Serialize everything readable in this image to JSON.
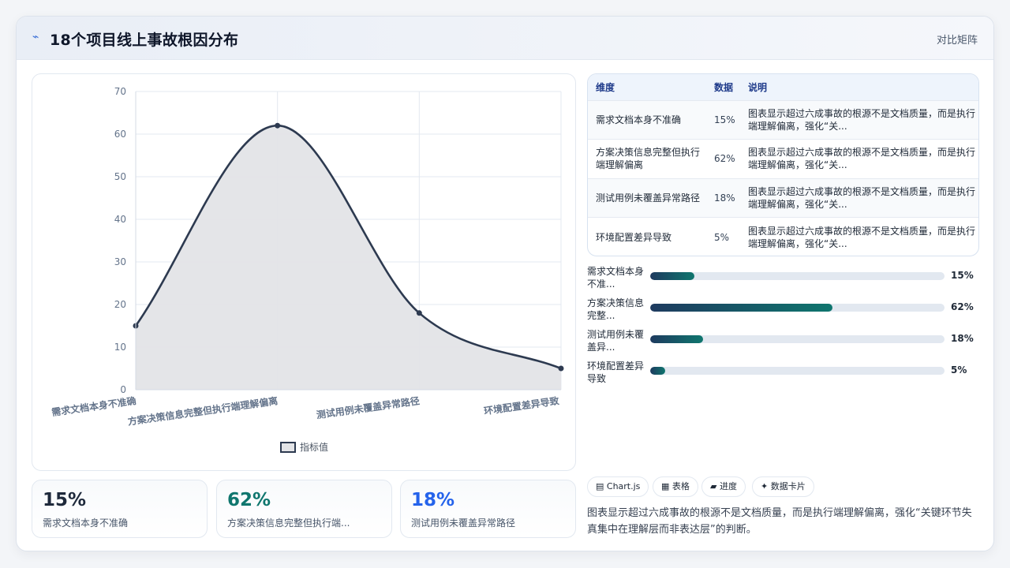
{
  "header": {
    "title": "18个项目线上事故根因分布",
    "title_icon": "⌁",
    "right_label": "对比矩阵"
  },
  "chart_data": {
    "type": "line",
    "categories": [
      "需求文档本身不准确",
      "方案决策信息完整但执行端理解偏离",
      "测试用例未覆盖异常路径",
      "环境配置差异导致"
    ],
    "series": [
      {
        "name": "指标值",
        "values": [
          15,
          62,
          18,
          5
        ]
      }
    ],
    "ylim": [
      0,
      70
    ],
    "yticks": [
      0,
      10,
      20,
      30,
      40,
      50,
      60,
      70
    ],
    "grid": true,
    "legend": "bottom",
    "colors": {
      "line": "#2d3a50",
      "fill": "#e3e4e7",
      "grid": "#e3e8f0",
      "tick": "#64748b"
    }
  },
  "table": {
    "headers": [
      "维度",
      "数据",
      "说明"
    ],
    "rows": [
      {
        "dim": "需求文档本身不准确",
        "value": "15%",
        "desc": "图表显示超过六成事故的根源不是文档质量，而是执行端理解偏离，强化“关..."
      },
      {
        "dim": "方案决策信息完整但执行端理解偏离",
        "value": "62%",
        "desc": "图表显示超过六成事故的根源不是文档质量，而是执行端理解偏离，强化“关..."
      },
      {
        "dim": "测试用例未覆盖异常路径",
        "value": "18%",
        "desc": "图表显示超过六成事故的根源不是文档质量，而是执行端理解偏离，强化“关..."
      },
      {
        "dim": "环境配置差异导致",
        "value": "5%",
        "desc": "图表显示超过六成事故的根源不是文档质量，而是执行端理解偏离，强化“关..."
      }
    ]
  },
  "progress": [
    {
      "label": "需求文档本身不准...",
      "value": "15%",
      "fraction": 0.15
    },
    {
      "label": "方案决策信息完整...",
      "value": "62%",
      "fraction": 0.62
    },
    {
      "label": "测试用例未覆盖异...",
      "value": "18%",
      "fraction": 0.18
    },
    {
      "label": "环境配置差异导致",
      "value": "5%",
      "fraction": 0.05
    }
  ],
  "kpis": [
    {
      "value": "15%",
      "label": "需求文档本身不准确",
      "color": "#1e293b"
    },
    {
      "value": "62%",
      "label": "方案决策信息完整但执行端...",
      "color": "#0f766e"
    },
    {
      "value": "18%",
      "label": "测试用例未覆盖异常路径",
      "color": "#2563eb"
    }
  ],
  "tags": [
    {
      "icon": "chart-icon",
      "label": "▤ Chart.js"
    },
    {
      "icon": "table-icon",
      "label": "▦ 表格"
    },
    {
      "icon": "progress-icon",
      "label": "▰ 进度"
    },
    {
      "icon": "sparkle-icon",
      "label": "✦ 数据卡片"
    }
  ],
  "summary": "图表显示超过六成事故的根源不是文档质量，而是执行端理解偏离，强化“关键环节失真集中在理解层而非表达层”的判断。"
}
